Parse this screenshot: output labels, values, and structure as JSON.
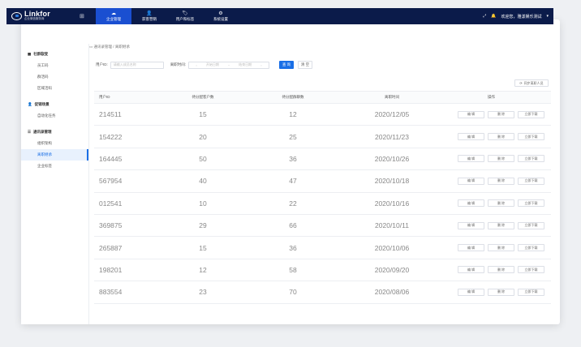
{
  "header": {
    "logo_title": "Linkfor",
    "logo_sub": "企业微信服务商",
    "nav": [
      {
        "label": "企业管理",
        "icon": "☁",
        "active": true
      },
      {
        "label": "获客营销",
        "icon": "👤",
        "active": false
      },
      {
        "label": "用户和标签",
        "icon": "🏷",
        "active": false
      },
      {
        "label": "系统设置",
        "icon": "⚙",
        "active": false
      }
    ],
    "greeting": "欢迎您，雅漾娱乐测试"
  },
  "sidebar": {
    "groups": [
      {
        "label": "社群裂变",
        "items": [
          "员工码",
          "群活码",
          "区域活码"
        ]
      },
      {
        "label": "促销场景",
        "items": [
          "自动化任务"
        ]
      },
      {
        "label": "通讯录管理",
        "items": [
          "组织架构",
          "离职继承",
          "企业标签"
        ]
      }
    ],
    "active_item": "离职继承"
  },
  "breadcrumb": {
    "parent": "通讯录管理",
    "sep": "/",
    "current": "离职继承"
  },
  "filter": {
    "user_label": "用户ID:",
    "user_placeholder": "请输入成员名称",
    "date_label": "离职时间:",
    "start_placeholder": "开始日期",
    "range_sep": "~",
    "end_placeholder": "结束日期",
    "search_label": "查 询",
    "reset_label": "清 空"
  },
  "sync_label": "同步离职人员",
  "table": {
    "headers": [
      "用户ID",
      "待分配客户数",
      "待分配群聊数",
      "离职时间",
      "操作"
    ],
    "actions": [
      "编 辑",
      "删 除",
      "立即下载"
    ],
    "rows": [
      {
        "id": "214511",
        "customers": "15",
        "groups": "12",
        "date": "2020/12/05"
      },
      {
        "id": "154222",
        "customers": "20",
        "groups": "25",
        "date": "2020/11/23"
      },
      {
        "id": "164445",
        "customers": "50",
        "groups": "36",
        "date": "2020/10/26"
      },
      {
        "id": "567954",
        "customers": "40",
        "groups": "47",
        "date": "2020/10/18"
      },
      {
        "id": "012541",
        "customers": "10",
        "groups": "22",
        "date": "2020/10/16"
      },
      {
        "id": "369875",
        "customers": "29",
        "groups": "66",
        "date": "2020/10/11"
      },
      {
        "id": "265887",
        "customers": "15",
        "groups": "36",
        "date": "2020/10/06"
      },
      {
        "id": "198201",
        "customers": "12",
        "groups": "58",
        "date": "2020/09/20"
      },
      {
        "id": "883554",
        "customers": "23",
        "groups": "70",
        "date": "2020/08/06"
      }
    ]
  }
}
